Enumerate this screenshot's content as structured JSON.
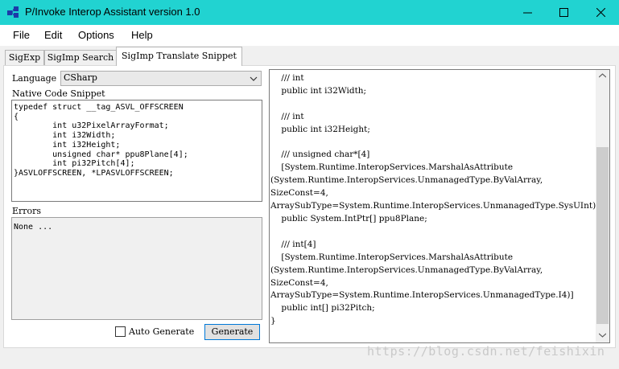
{
  "window": {
    "title": "P/Invoke Interop Assistant version 1.0",
    "accent_color": "#21d3d1"
  },
  "menu": [
    "File",
    "Edit",
    "Options",
    "Help"
  ],
  "tabs": [
    "SigExp",
    "SigImp Search",
    "SigImp Translate Snippet"
  ],
  "active_tab": "SigImp Translate Snippet",
  "language": {
    "label": "Language",
    "selected": "CSharp"
  },
  "snippet": {
    "label": "Native Code Snippet",
    "code": "typedef struct __tag_ASVL_OFFSCREEN\n{\n        int u32PixelArrayFormat;\n        int i32Width;\n        int i32Height;\n        unsigned char* ppu8Plane[4];\n        int pi32Pitch[4];\n}ASVLOFFSCREEN, *LPASVLOFFSCREEN;"
  },
  "errors": {
    "label": "Errors",
    "text": "None ..."
  },
  "auto_generate": {
    "label": "Auto Generate",
    "checked": false
  },
  "generate_button": "Generate",
  "output": {
    "text": "    /// int\n    public int i32Width;\n\n    /// int\n    public int i32Height;\n\n    /// unsigned char*[4]\n    [System.Runtime.InteropServices.MarshalAsAttribute\n(System.Runtime.InteropServices.UnmanagedType.ByValArray,\nSizeConst=4,\nArraySubType=System.Runtime.InteropServices.UnmanagedType.SysUInt)]\n    public System.IntPtr[] ppu8Plane;\n\n    /// int[4]\n    [System.Runtime.InteropServices.MarshalAsAttribute\n(System.Runtime.InteropServices.UnmanagedType.ByValArray,\nSizeConst=4,\nArraySubType=System.Runtime.InteropServices.UnmanagedType.I4)]\n    public int[] pi32Pitch;\n}"
  },
  "watermark": "https://blog.csdn.net/feishixin"
}
